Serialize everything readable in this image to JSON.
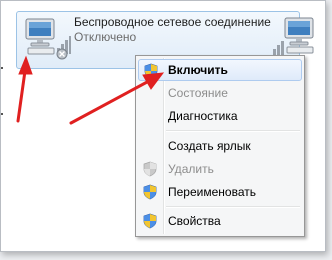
{
  "adapter": {
    "name": "Беспроводное сетевое соединение",
    "status": "Отключено",
    "icon": "network-computer-icon"
  },
  "second_adapter": {
    "icon": "network-computer-icon"
  },
  "context_menu": {
    "items": [
      {
        "label": "Включить",
        "bold": true,
        "disabled": false,
        "highlighted": true,
        "icon": "shield-icon"
      },
      {
        "label": "Состояние",
        "bold": false,
        "disabled": true,
        "highlighted": false,
        "icon": ""
      },
      {
        "label": "Диагностика",
        "bold": false,
        "disabled": false,
        "highlighted": false,
        "icon": ""
      },
      {
        "label": "Создать ярлык",
        "bold": false,
        "disabled": false,
        "highlighted": false,
        "icon": ""
      },
      {
        "label": "Удалить",
        "bold": false,
        "disabled": true,
        "highlighted": false,
        "icon": "shield-icon"
      },
      {
        "label": "Переименовать",
        "bold": false,
        "disabled": false,
        "highlighted": false,
        "icon": "shield-icon"
      },
      {
        "label": "Свойства",
        "bold": false,
        "disabled": false,
        "highlighted": false,
        "icon": "shield-icon"
      }
    ]
  },
  "colors": {
    "selection_border": "#aecbef",
    "arrow": "#e02020"
  }
}
